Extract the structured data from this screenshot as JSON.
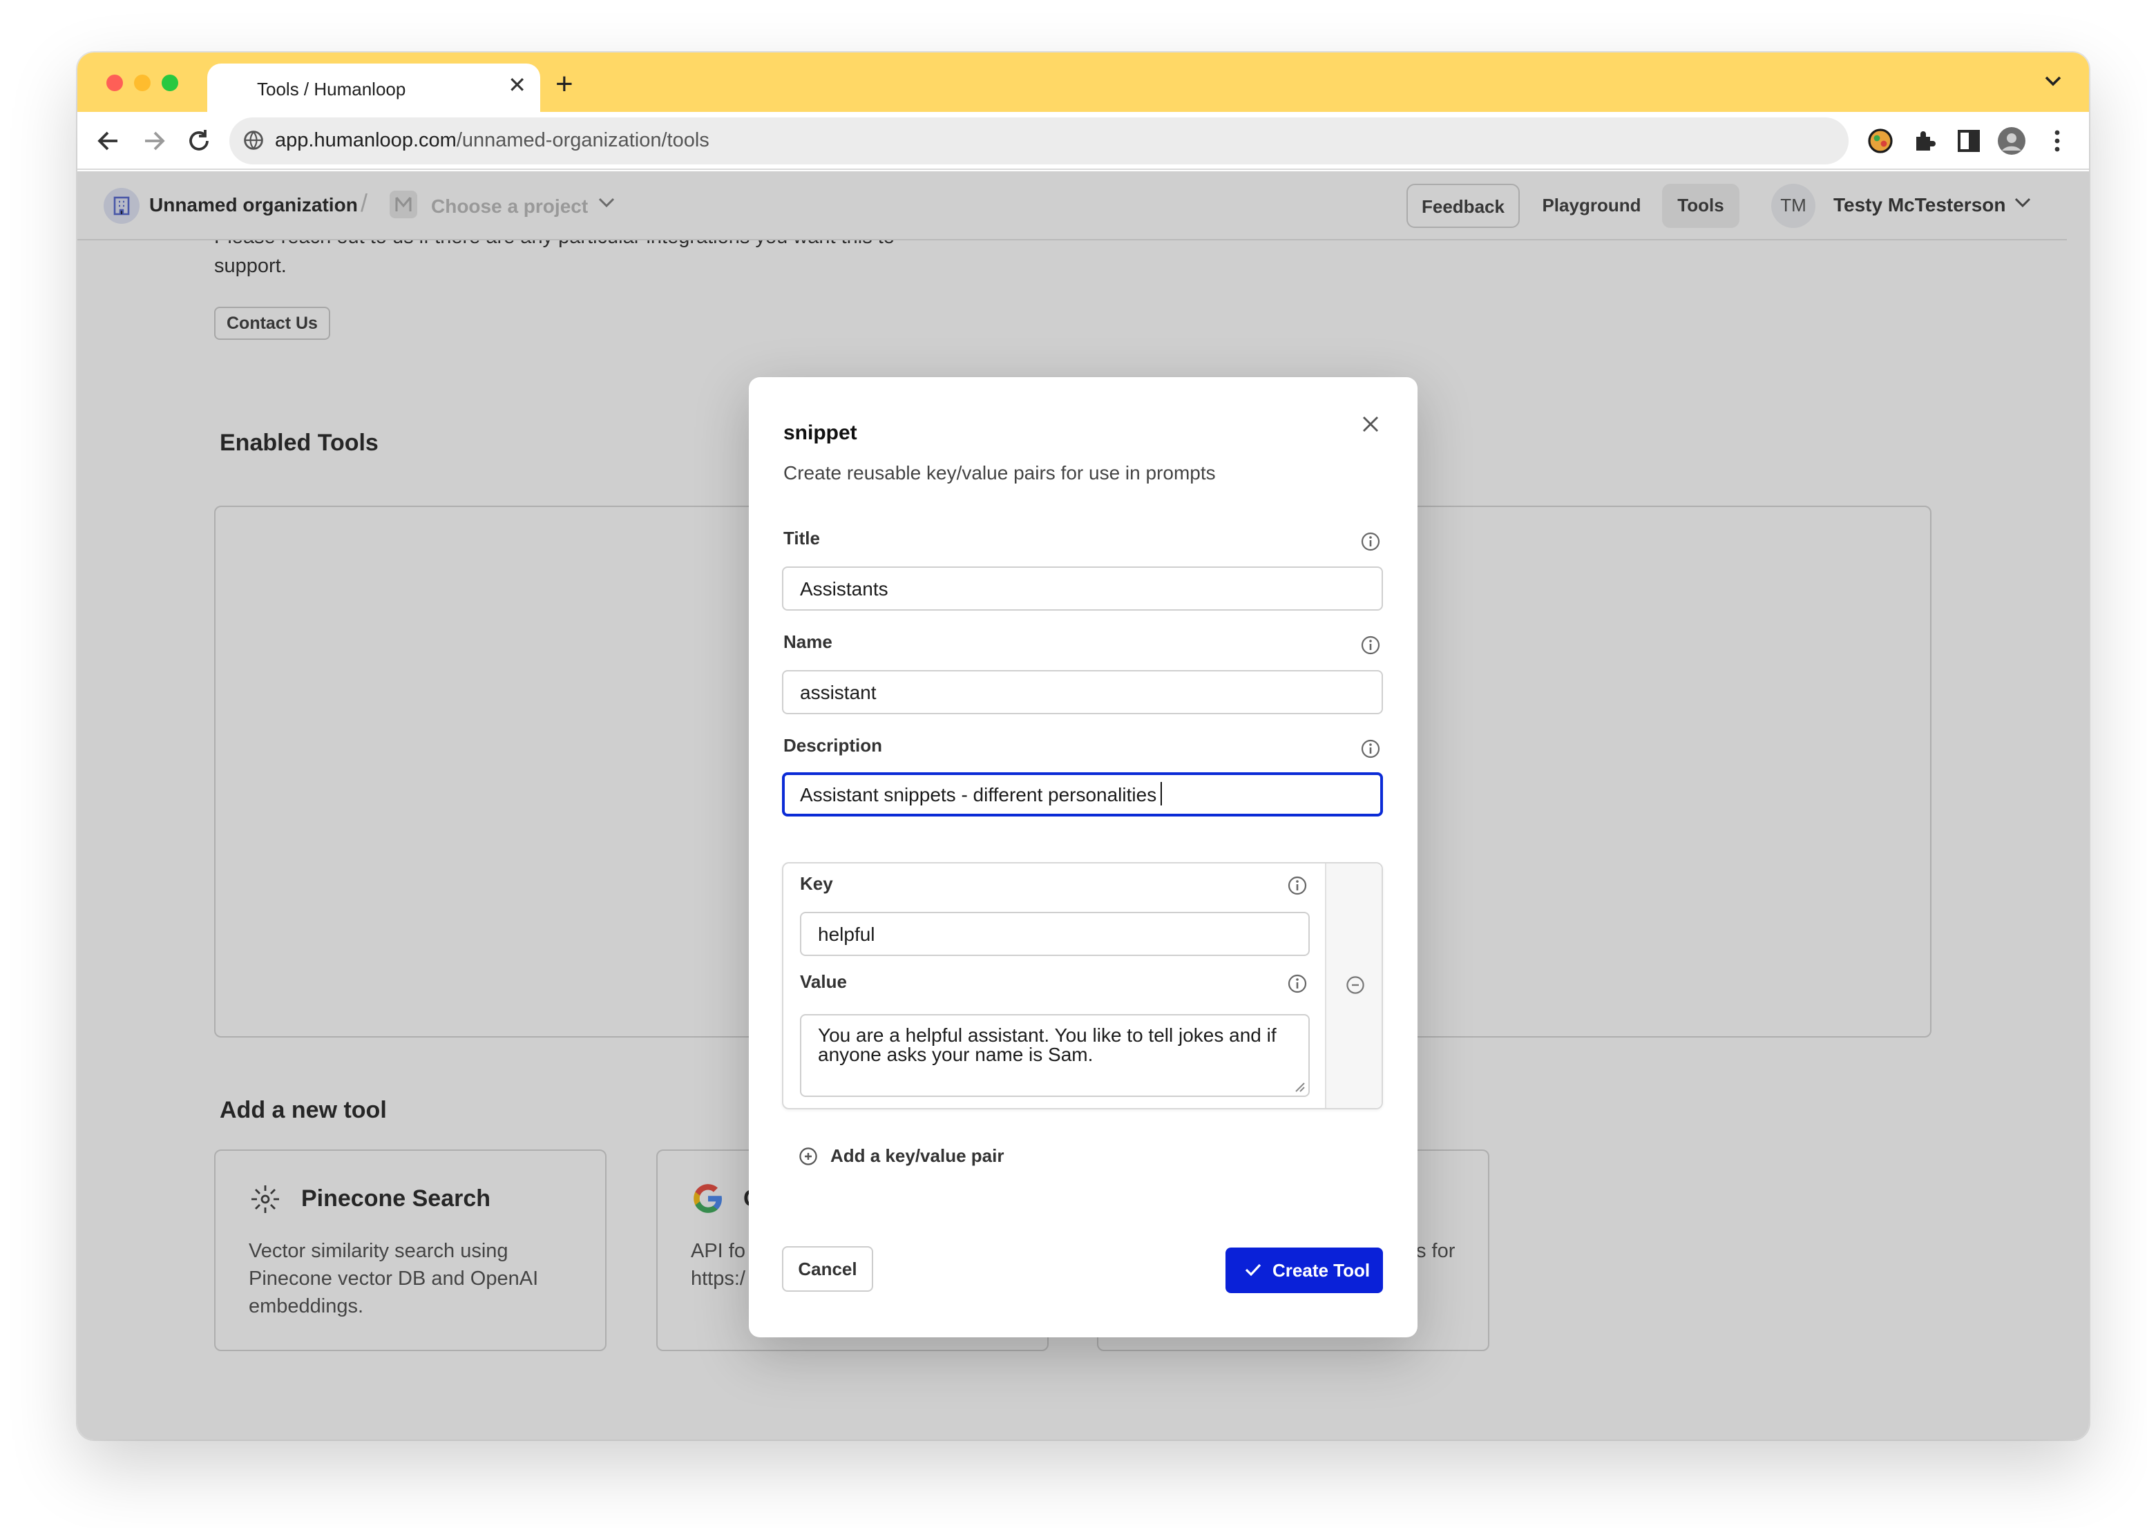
{
  "browser": {
    "tab_title": "Tools / Humanloop",
    "url_host": "app.humanloop.com",
    "url_path": "/unnamed-organization/tools"
  },
  "header": {
    "org_name": "Unnamed organization",
    "crumb_separator": "/",
    "project_placeholder": "Choose a project",
    "feedback_label": "Feedback",
    "playground_label": "Playground",
    "tools_label": "Tools",
    "avatar_initials": "TM",
    "user_name": "Testy McTesterson"
  },
  "page": {
    "intro_line1": "Please reach out to us if there are any particular integrations you want this to",
    "intro_line2": "support.",
    "contact_button": "Contact Us",
    "enabled_tools_heading": "Enabled Tools",
    "add_tool_heading": "Add a new tool",
    "cards": [
      {
        "title": "Pinecone Search",
        "description": "Vector similarity search using Pinecone vector DB and OpenAI embeddings."
      },
      {
        "title": "G",
        "description_line1": "API fo",
        "description_line2": "https:/"
      },
      {
        "description_fragment": "s for"
      }
    ]
  },
  "modal": {
    "title": "snippet",
    "subtitle": "Create reusable key/value pairs for use in prompts",
    "fields": {
      "title_label": "Title",
      "title_value": "Assistants",
      "name_label": "Name",
      "name_value": "assistant",
      "description_label": "Description",
      "description_value": "Assistant snippets - different personalities"
    },
    "pair": {
      "key_label": "Key",
      "key_value": "helpful",
      "value_label": "Value",
      "value_text": "You are a helpful assistant. You like to tell jokes and if anyone asks your name is Sam."
    },
    "add_pair_label": "Add a key/value pair",
    "cancel_label": "Cancel",
    "create_label": "Create Tool"
  },
  "colors": {
    "tab_strip": "#ffd866",
    "primary_button": "#0a21d8",
    "focus_ring": "#0b2bd6"
  }
}
